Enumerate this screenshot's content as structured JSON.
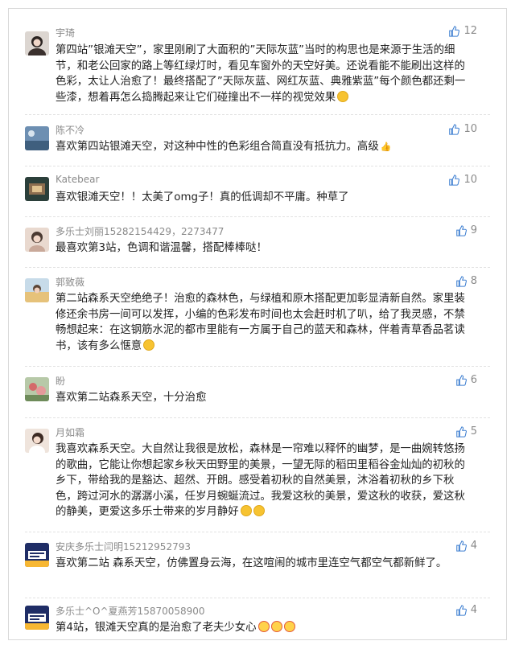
{
  "comments": [
    {
      "name": "宇琦",
      "likes": "12",
      "text": "第四站”银滩天空”，家里刚刷了大面积的”天际灰蓝”当时的构思也是来源于生活的细节，和老公回家的路上等红绿灯时，看见车窗外的天空好美。还说看能不能刷出这样的色彩，太让人治愈了！最终搭配了”天际灰蓝、网红灰蓝、典雅紫蓝”每个颜色都还剩一些漆，想着再怎么捣腾起来让它们碰撞出不一样的视觉效果",
      "emoji": "grin"
    },
    {
      "name": "陈不冷",
      "likes": "10",
      "text": "喜欢第四站银滩天空，对这种中性的色彩组合简直没有抵抗力。高级",
      "emoji": "hand"
    },
    {
      "name": "Katebear",
      "likes": "10",
      "text": "喜欢银滩天空！！太美了omg子！真的低调却不平庸。种草了",
      "emoji": ""
    },
    {
      "name": "多乐士刘丽15282154429，2273477",
      "likes": "9",
      "text": "最喜欢第3站，色调和谐温馨，搭配棒棒哒！",
      "emoji": ""
    },
    {
      "name": "郭致薇",
      "likes": "8",
      "text": "第二站森系天空绝绝子！治愈的森林色，与绿植和原木搭配更加彰显清新自然。家里装修还余书房一间可以发挥，小编的色彩发布时间也太会赶时机了叭，给了我灵感，不禁畅想起来：在这钢筋水泥的都市里能有一方属于自己的蓝天和森林，伴着青草香品茗读书，该有多么惬意",
      "emoji": "wink"
    },
    {
      "name": "盼",
      "likes": "6",
      "text": "喜欢第二站森系天空，十分治愈",
      "emoji": ""
    },
    {
      "name": "月如霜",
      "likes": "5",
      "text": "我喜欢森系天空。大自然让我很是放松，森林是一帘难以释怀的幽梦，是一曲婉转悠扬的歌曲，它能让你想起家乡秋天田野里的美景，一望无际的稻田里稻谷金灿灿的初秋的乡下，带给我的是豁达、超然、开朗。感受着初秋的自然美景，沐浴着初秋的乡下秋色，跨过河水的潺潺小溪，任岁月蜿蜒流过。我爱这秋的美景，爱这秋的收获，爱这秋的静美，更爱这多乐士带来的岁月静好",
      "emoji": "heart2"
    },
    {
      "name": "安庆多乐士闫明15212952793",
      "likes": "4",
      "text": "喜欢第二站 森系天空，仿佛置身云海，在这喧闹的城市里连空气都空气都新鲜了。",
      "emoji": ""
    },
    {
      "name": "多乐士^O^夏燕芳15870058900",
      "likes": "4",
      "text": "第4站，银滩天空真的是治愈了老夫少女心",
      "emoji": "wow3"
    }
  ],
  "colors": {
    "name": "#8a8a8a",
    "text": "#222222",
    "thumb": "#3e7fd1"
  },
  "icons": {
    "like": "thumbs-up-icon"
  }
}
